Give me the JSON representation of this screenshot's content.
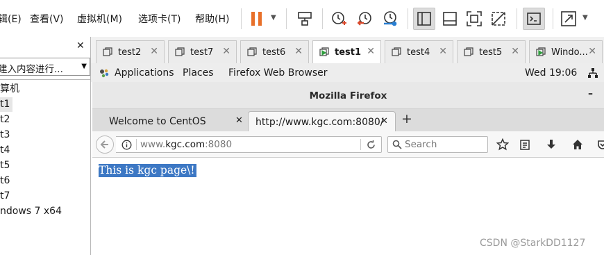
{
  "menu": {
    "items": [
      "辑(E)",
      "查看(V)",
      "虚拟机(M)",
      "选项卡(T)",
      "帮助(H)"
    ]
  },
  "toolbar": {
    "icons": [
      "pause-icon",
      "send-ctrl-alt-del-icon",
      "snapshot-take-icon",
      "snapshot-revert-icon",
      "snapshot-manager-icon",
      "show-library-icon",
      "show-thumbnail-bar-icon",
      "full-screen-icon",
      "unity-icon",
      "console-view-icon",
      "stretch-guest-icon"
    ],
    "accent": "#e8702a"
  },
  "library": {
    "search_placeholder": "建入内容进行...",
    "items": [
      "算机",
      "t1",
      "t2",
      "t3",
      "t4",
      "t5",
      "t6",
      "t7",
      "ndows 7 x64"
    ],
    "selected_index": 1
  },
  "vm_tabs": [
    {
      "label": "test2",
      "active": false
    },
    {
      "label": "test7",
      "active": false
    },
    {
      "label": "test6",
      "active": false
    },
    {
      "label": "test1",
      "active": true
    },
    {
      "label": "test4",
      "active": false
    },
    {
      "label": "test5",
      "active": false
    },
    {
      "label": "Windo...",
      "active": false
    }
  ],
  "gnome": {
    "applications": "Applications",
    "places": "Places",
    "active_app": "Firefox Web Browser",
    "clock": "Wed 19:06"
  },
  "firefox": {
    "window_title": "Mozilla Firefox",
    "tabs": [
      {
        "label": "Welcome to CentOS",
        "active": false
      },
      {
        "label": "http://www.kgc.com:8080/",
        "active": true
      }
    ],
    "url_prefix": "www.",
    "url_host": "kgc.com",
    "url_suffix": ":8080",
    "search_placeholder": "Search"
  },
  "page": {
    "content": "This is kgc page\\!"
  },
  "watermark": "CSDN @StarkDD1127",
  "colors": {
    "selection": "#3d78c4",
    "play_green": "#2f9e3e",
    "snapshot_red": "#d9482b",
    "snapshot_blue": "#2a7fd1"
  }
}
